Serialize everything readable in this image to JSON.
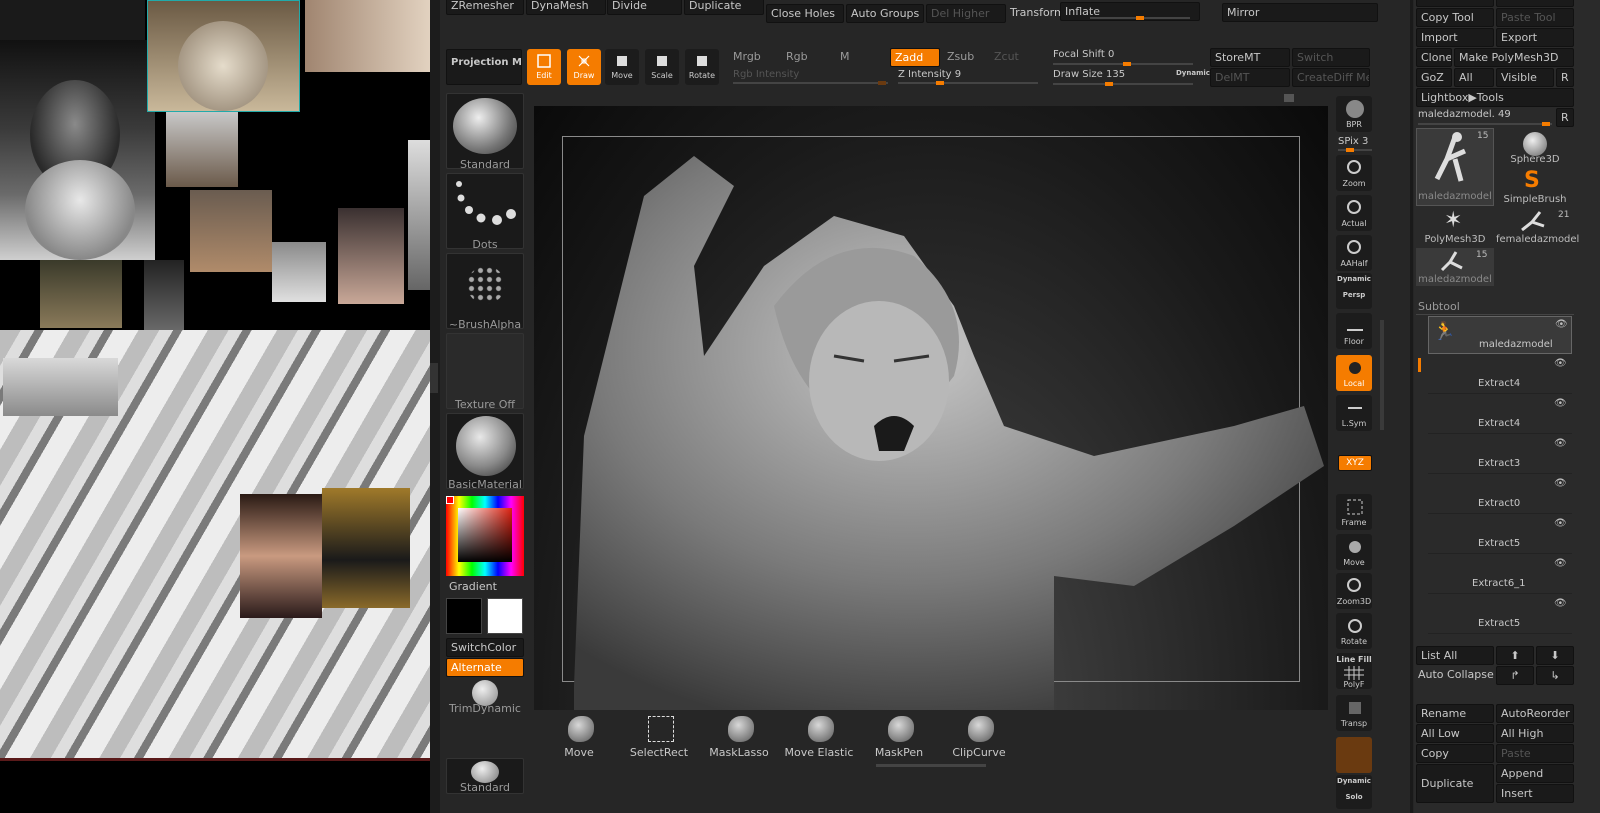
{
  "top_bar": {
    "zremesher": "ZRemesher",
    "dynamesh": "DynaMesh",
    "divide": "Divide",
    "duplicate": "Duplicate",
    "close_holes": "Close Holes",
    "auto_groups": "Auto Groups",
    "del_higher": "Del Higher",
    "transform": "Transform",
    "inflate": "Inflate",
    "mirror": "Mirror"
  },
  "toolbar": {
    "projection_master": "Projection Master",
    "edit": "Edit",
    "draw": "Draw",
    "move": "Move",
    "scale": "Scale",
    "rotate": "Rotate",
    "mrgb": "Mrgb",
    "rgb": "Rgb",
    "m": "M",
    "zadd": "Zadd",
    "zsub": "Zsub",
    "zcut": "Zcut",
    "rgb_intensity": "Rgb Intensity",
    "z_intensity": "Z Intensity 9",
    "focal_shift": "Focal Shift 0",
    "draw_size": "Draw Size 135",
    "dynamic": "Dynamic",
    "storemt": "StoreMT",
    "switch": "Switch",
    "delmt": "DelMT",
    "creatediff": "CreateDiff Mesh"
  },
  "left_shelf": {
    "standard": "Standard",
    "dots": "Dots",
    "brush_alpha": "~BrushAlpha",
    "texture_off": "Texture Off",
    "basic_material": "BasicMaterial",
    "gradient": "Gradient",
    "switch_color": "SwitchColor",
    "alternate": "Alternate",
    "trim_dynamic": "TrimDynamic",
    "standard_bottom": "Standard"
  },
  "right_shelf": {
    "bpr": "BPR",
    "spix": "SPix 3",
    "zoom": "Zoom",
    "actual": "Actual",
    "aahalf": "AAHalf",
    "dynamic": "Dynamic",
    "persp": "Persp",
    "floor": "Floor",
    "local": "Local",
    "lsym": "L.Sym",
    "xyz": "XYZ",
    "frame": "Frame",
    "move": "Move",
    "zoom3d": "Zoom3D",
    "rotate": "Rotate",
    "line_fill": "Line Fill",
    "polyf": "PolyF",
    "transp": "Transp",
    "dynamic2": "Dynamic",
    "solo": "Solo"
  },
  "bottom_brushes": [
    "Move",
    "SelectRect",
    "MaskLasso",
    "Move Elastic",
    "MaskPen",
    "ClipCurve"
  ],
  "tool_panel": {
    "copy_tool": "Copy Tool",
    "paste_tool": "Paste Tool",
    "import": "Import",
    "export": "Export",
    "clone": "Clone",
    "make_polymesh": "Make PolyMesh3D",
    "goz": "GoZ",
    "all": "All",
    "visible": "Visible",
    "r": "R",
    "lightbox_tools": "Lightbox▶Tools",
    "current_tool": "maledazmodel. 49",
    "tools": [
      {
        "name": "maledazmodel",
        "count": "15"
      },
      {
        "name": "Sphere3D",
        "count": ""
      },
      {
        "name": "SimpleBrush",
        "count": ""
      },
      {
        "name": "PolyMesh3D",
        "count": ""
      },
      {
        "name": "femaledazmodel",
        "count": "21"
      },
      {
        "name": "maledazmodel",
        "count": "15"
      }
    ],
    "subtool_header": "Subtool",
    "subtools": [
      "maledazmodel",
      "Extract4",
      "Extract4",
      "Extract3",
      "Extract0",
      "Extract5",
      "Extract6_1",
      "Extract5"
    ],
    "list_all": "List All",
    "auto_collapse": "Auto Collapse",
    "rename": "Rename",
    "auto_reorder": "AutoReorder",
    "all_low": "All Low",
    "all_high": "All High",
    "copy": "Copy",
    "paste": "Paste",
    "duplicate": "Duplicate",
    "append": "Append",
    "insert": "Insert"
  },
  "colors": {
    "accent": "#f57c00",
    "panel": "#262626",
    "button": "#1a1a1a"
  }
}
